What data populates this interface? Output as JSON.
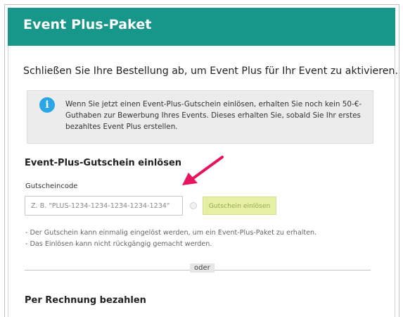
{
  "header": {
    "title": "Event Plus-Paket",
    "background": "#17968a"
  },
  "intro": {
    "text": "Schließen Sie Ihre Bestellung ab, um Event Plus für Ihr Event zu aktivieren."
  },
  "info": {
    "icon": "info-icon",
    "icon_glyph": "i",
    "text": "Wenn Sie jetzt einen Event-Plus-Gutschein einlösen, erhalten Sie noch kein 50-€-Guthaben zur Bewerbung Ihres Events. Dieses erhalten Sie, sobald Sie Ihr erstes bezahltes Event Plus erstellen."
  },
  "voucher": {
    "title": "Event-Plus-Gutschein einlösen",
    "field_label": "Gutscheincode",
    "placeholder": "Z. B. \"PLUS-1234-1234-1234-1234-1234\"",
    "value": "",
    "redeem_label": "Gutschein einlösen",
    "notes": [
      "Der Gutschein kann einmalig eingelöst werden, um ein Event-Plus-Paket zu erhalten.",
      "Das Einlösen kann nicht rückgängig gemacht werden."
    ]
  },
  "divider": {
    "label": "oder"
  },
  "invoice": {
    "title": "Per Rechnung bezahlen"
  },
  "annotation": {
    "icon": "arrow-icon",
    "color": "#e8135f"
  }
}
